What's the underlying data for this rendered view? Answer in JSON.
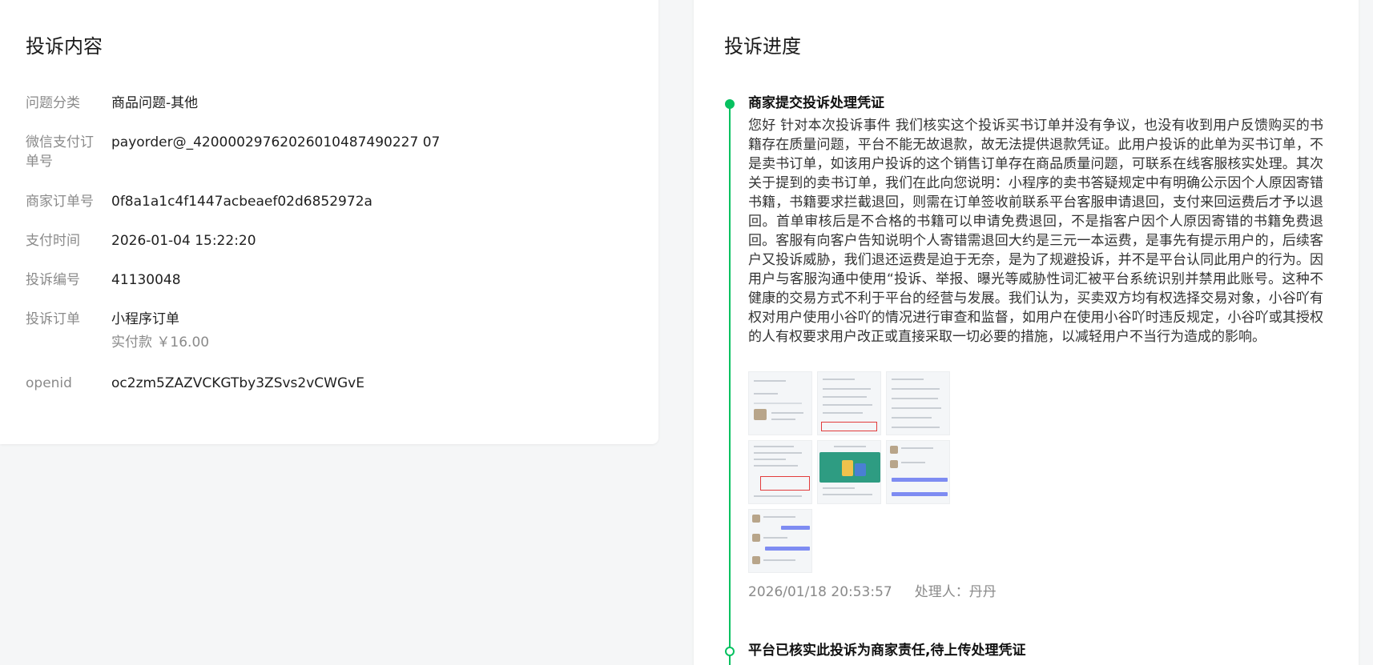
{
  "complaint_content": {
    "title": "投诉内容",
    "rows": [
      {
        "label": "问题分类",
        "value": "商品问题-其他"
      },
      {
        "label": "微信支付订单号",
        "value": "payorder@_42000029762026010487490227 07"
      },
      {
        "label": "商家订单号",
        "value": "0f8a1a1c4f1447acbeaef02d6852972a"
      },
      {
        "label": "支付时间",
        "value": "2026-01-04 15:22:20"
      },
      {
        "label": "投诉编号",
        "value": "41130048"
      },
      {
        "label": "投诉订单",
        "value": "小程序订单",
        "sub": "实付款 ￥16.00"
      },
      {
        "label": "openid",
        "value": "oc2zm5ZAZVCKGTby3ZSvs2vCWGvE"
      }
    ]
  },
  "complaint_progress": {
    "title": "投诉进度",
    "entries": [
      {
        "title": "商家提交投诉处理凭证",
        "description": "您好 针对本次投诉事件 我们核实这个投诉买书订单并没有争议，也没有收到用户反馈购买的书籍存在质量问题，平台不能无故退款，故无法提供退款凭证。此用户投诉的此单为买书订单，不是卖书订单，如该用户投诉的这个销售订单存在商品质量问题，可联系在线客服核实处理。其次关于提到的卖书订单，我们在此向您说明：小程序的卖书答疑规定中有明确公示因个人原因寄错书籍，书籍要求拦截退回，则需在订单签收前联系平台客服申请退回，支付来回运费后才予以退回。首单审核后是不合格的书籍可以申请免费退回，不是指客户因个人原因寄错的书籍免费退回。客服有向客户告知说明个人寄错需退回大约是三元一本运费，是事先有提示用户的，后续客户又投诉威胁，我们退还运费是迫于无奈，是为了规避投诉，并不是平台认同此用户的行为。因用户与客服沟通中使用“投诉、举报、曝光等威胁性词汇被平台系统识别并禁用此账号。这种不健康的交易方式不利于平台的经营与发展。我们认为，买卖双方均有权选择交易对象，小谷吖有权对用户使用小谷吖的情况进行审查和监督，如用户在使用小谷吖时违反规定，小谷吖或其授权的人有权要求用户改正或直接采取一切必要的措施，以减轻用户不当行为造成的影响。",
        "time": "2026/01/18 20:53:57",
        "handler": "处理人：丹丹"
      },
      {
        "title": "平台已核实此投诉为商家责任,待上传处理凭证"
      }
    ]
  },
  "colors": {
    "accent": "#07c160",
    "label": "#8a8a8a",
    "background": "#f5f6f7"
  }
}
